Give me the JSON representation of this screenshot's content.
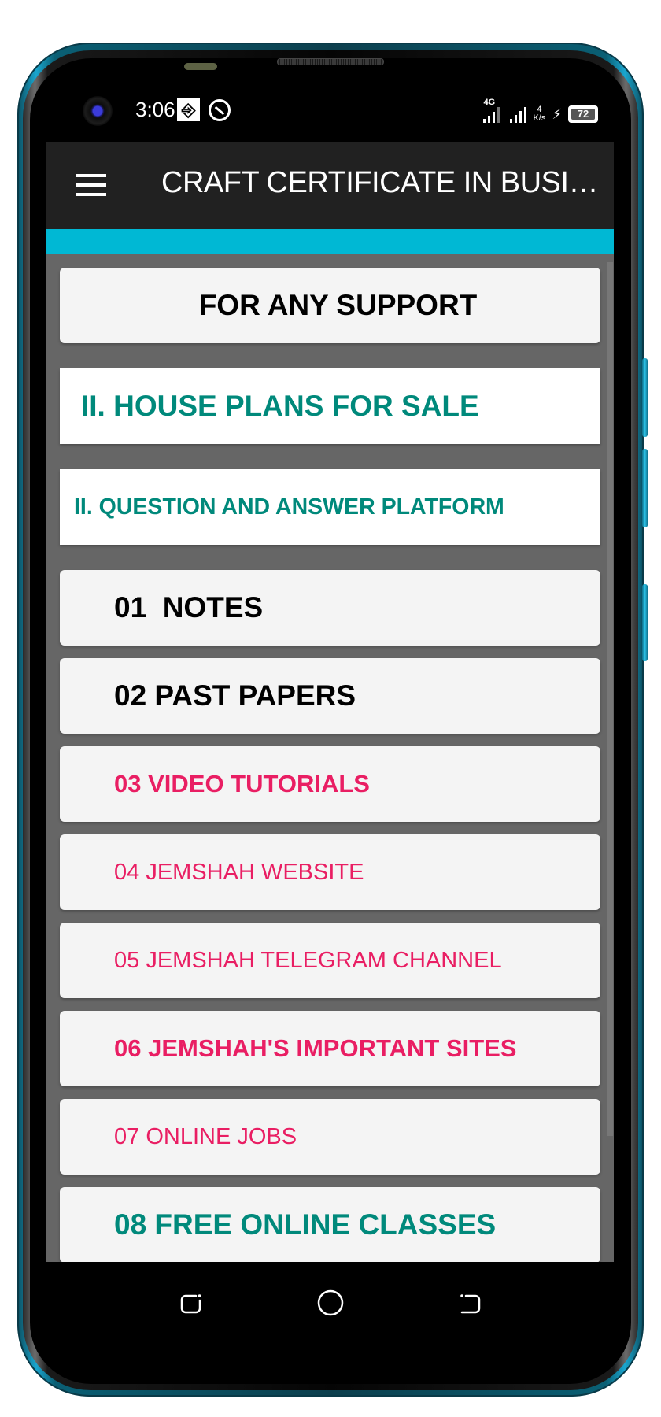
{
  "status_bar": {
    "time": "3:06",
    "network_type": "4G",
    "speed_value": "4",
    "speed_unit": "K/s",
    "battery_level": "72",
    "icons": [
      "usb-icon",
      "q-notification-icon",
      "signal-4g-icon",
      "signal-bars-icon",
      "charging-icon",
      "battery-icon"
    ]
  },
  "app_bar": {
    "menu_icon": "hamburger-menu-icon",
    "title": "CRAFT CERTIFICATE IN BUSINESS MANAGEMENT",
    "accent_color": "#00b8d4",
    "background_color": "#212121"
  },
  "menu": {
    "items": [
      {
        "label": "FOR ANY SUPPORT",
        "color": "#000000",
        "style": "grey-rounded"
      },
      {
        "label": "II. HOUSE PLANS FOR SALE",
        "color": "#00897b",
        "style": "white"
      },
      {
        "label": "II. QUESTION AND ANSWER PLATFORM",
        "color": "#00897b",
        "style": "white"
      },
      {
        "label": "01  NOTES",
        "color": "#000000",
        "style": "grey-rounded"
      },
      {
        "label": "02 PAST PAPERS",
        "color": "#000000",
        "style": "grey-rounded"
      },
      {
        "label": "03 VIDEO TUTORIALS",
        "color": "#e91e63",
        "style": "grey-rounded"
      },
      {
        "label": "04 JEMSHAH WEBSITE",
        "color": "#e91e63",
        "style": "grey-rounded"
      },
      {
        "label": "05 JEMSHAH TELEGRAM CHANNEL",
        "color": "#e91e63",
        "style": "grey-rounded"
      },
      {
        "label": "06 JEMSHAH'S IMPORTANT SITES",
        "color": "#e91e63",
        "style": "grey-rounded"
      },
      {
        "label": "07 ONLINE JOBS",
        "color": "#e91e63",
        "style": "grey-rounded"
      },
      {
        "label": "08 FREE ONLINE CLASSES",
        "color": "#00897b",
        "style": "grey-rounded"
      }
    ]
  },
  "nav_bar": {
    "buttons": [
      "recent-apps-icon",
      "home-icon",
      "back-icon"
    ]
  }
}
